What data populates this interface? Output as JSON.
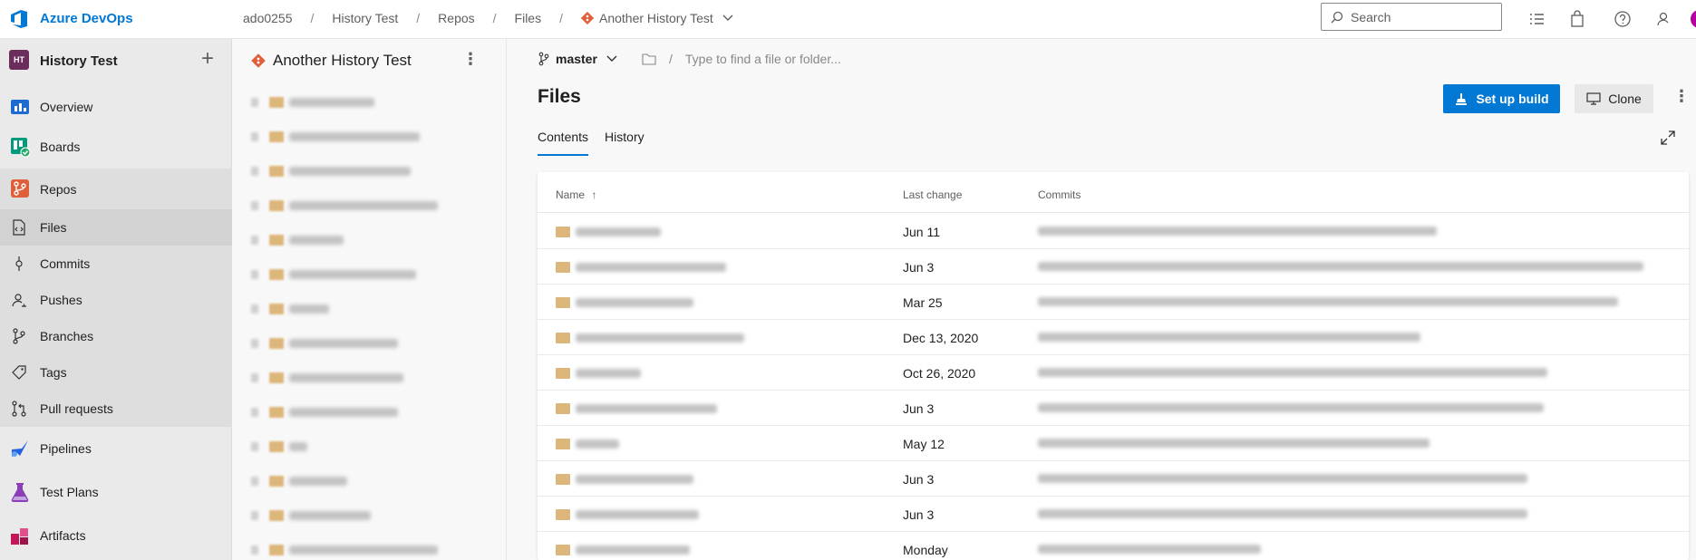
{
  "brand": "Azure DevOps",
  "breadcrumbs": [
    "ado0255",
    "History Test",
    "Repos",
    "Files",
    "Another History Test"
  ],
  "search": {
    "placeholder": "Search"
  },
  "project": {
    "badge": "HT",
    "name": "History Test",
    "add": "+"
  },
  "nav": {
    "overview": "Overview",
    "boards": "Boards",
    "repos": "Repos",
    "files": "Files",
    "commits": "Commits",
    "pushes": "Pushes",
    "branches": "Branches",
    "tags": "Tags",
    "pull_requests": "Pull requests",
    "pipelines": "Pipelines",
    "test_plans": "Test Plans",
    "artifacts": "Artifacts"
  },
  "tree": {
    "title": "Another History Test",
    "more": "⋮"
  },
  "branch": {
    "name": "master"
  },
  "path": {
    "placeholder": "Type to find a file or folder..."
  },
  "main": {
    "title": "Files",
    "setup_build": "Set up build",
    "clone": "Clone",
    "more": "⋮",
    "tabs": [
      "Contents",
      "History"
    ]
  },
  "table": {
    "headers": {
      "name": "Name",
      "sort": "↑",
      "last_change": "Last change",
      "commits": "Commits"
    },
    "rows": [
      {
        "date": "Jun 11"
      },
      {
        "date": "Jun 3"
      },
      {
        "date": "Mar 25"
      },
      {
        "date": "Dec 13, 2020"
      },
      {
        "date": "Oct 26, 2020"
      },
      {
        "date": "Jun 3"
      },
      {
        "date": "May 12"
      },
      {
        "date": "Jun 3"
      },
      {
        "date": "Jun 3"
      },
      {
        "date": "Monday"
      }
    ]
  },
  "colors": {
    "accent": "#0078d4",
    "folder": "#dcb67a",
    "repo": "#e05f3b",
    "project_badge": "#6b2d5c"
  }
}
